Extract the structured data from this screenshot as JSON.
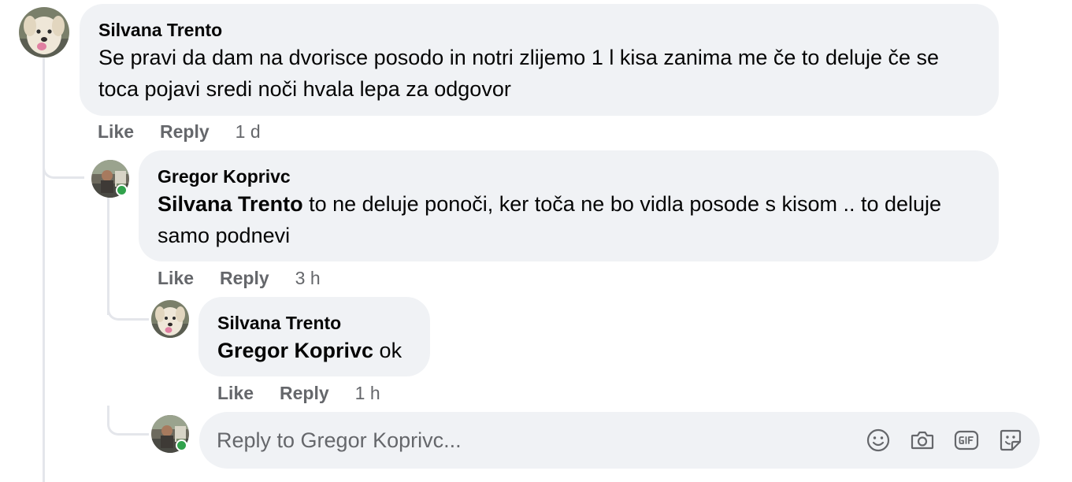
{
  "comments": [
    {
      "author": "Silvana Trento",
      "text": "Se pravi da dam na dvorisce posodo in notri zlijemo 1 l kisa zanima me če to deluje če se toca pojavi sredi noči hvala lepa za odgovor",
      "like_label": "Like",
      "reply_label": "Reply",
      "time": "1 d"
    },
    {
      "author": "Gregor Koprivc",
      "mention": "Silvana Trento",
      "text": " to ne deluje ponoči, ker toča ne bo vidla posode s kisom .. to deluje samo podnevi",
      "like_label": "Like",
      "reply_label": "Reply",
      "time": "3 h",
      "online": true
    },
    {
      "author": "Silvana Trento",
      "mention": "Gregor Koprivc",
      "text": " ok",
      "like_label": "Like",
      "reply_label": "Reply",
      "time": "1 h"
    }
  ],
  "reply": {
    "placeholder": "Reply to Gregor Koprivc...",
    "icons": [
      "emoji-icon",
      "camera-icon",
      "gif-icon",
      "sticker-icon"
    ]
  },
  "colors": {
    "bubble": "#f0f2f5",
    "secondary_text": "#65676b",
    "online": "#31a24c",
    "thread_line": "#e4e6eb"
  }
}
